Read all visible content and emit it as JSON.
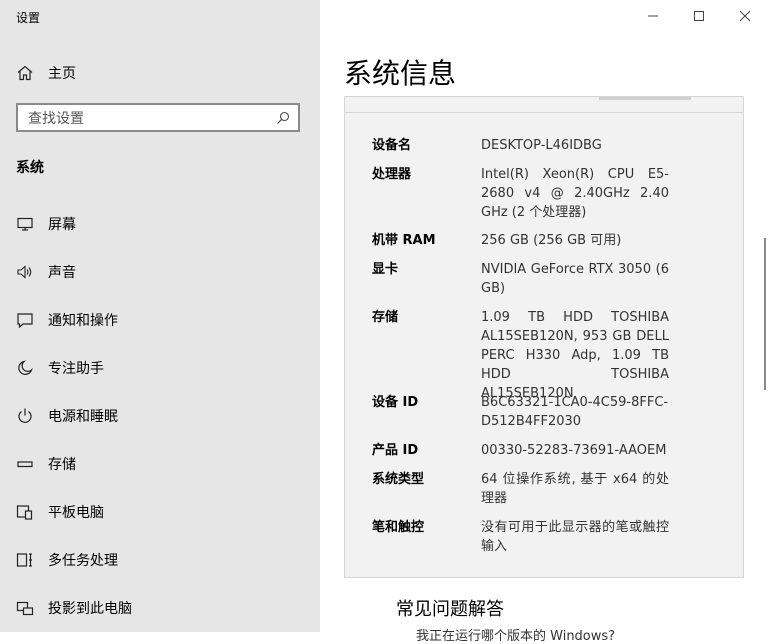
{
  "window": {
    "title": "设置"
  },
  "sidebar": {
    "home_label": "主页",
    "search_placeholder": "查找设置",
    "section_title": "系统",
    "items": [
      {
        "label": "屏幕",
        "icon": "monitor-icon"
      },
      {
        "label": "声音",
        "icon": "speaker-icon"
      },
      {
        "label": "通知和操作",
        "icon": "notification-icon"
      },
      {
        "label": "专注助手",
        "icon": "moon-icon"
      },
      {
        "label": "电源和睡眠",
        "icon": "power-icon"
      },
      {
        "label": "存储",
        "icon": "storage-icon"
      },
      {
        "label": "平板电脑",
        "icon": "tablet-icon"
      },
      {
        "label": "多任务处理",
        "icon": "multitask-icon"
      },
      {
        "label": "投影到此电脑",
        "icon": "project-icon"
      }
    ]
  },
  "main": {
    "title": "系统信息",
    "specs": [
      {
        "key": "设备名",
        "value": "DESKTOP-L46IDBG"
      },
      {
        "key": "处理器",
        "value": "Intel(R) Xeon(R) CPU E5-2680 v4 @ 2.40GHz   2.40 GHz  (2 个处理器)"
      },
      {
        "key": "机带 RAM",
        "value": "256 GB (256 GB 可用)"
      },
      {
        "key": "显卡",
        "value": "NVIDIA GeForce RTX 3050 (6 GB)"
      },
      {
        "key": "存储",
        "value": "1.09 TB HDD TOSHIBA AL15SEB120N, 953 GB DELL PERC H330 Adp, 1.09 TB HDD TOSHIBA AL15SEB120N"
      },
      {
        "key": "设备 ID",
        "value": "B6C63321-1CA0-4C59-8FFC-D512B4FF2030"
      },
      {
        "key": "产品 ID",
        "value": "00330-52283-73691-AAOEM"
      },
      {
        "key": "系统类型",
        "value": "64 位操作系统, 基于 x64 的处理器"
      },
      {
        "key": "笔和触控",
        "value": "没有可用于此显示器的笔或触控输入"
      }
    ],
    "faq_title": "常见问题解答",
    "faq_peek": "我正在运行哪个版本的 Windows?"
  }
}
